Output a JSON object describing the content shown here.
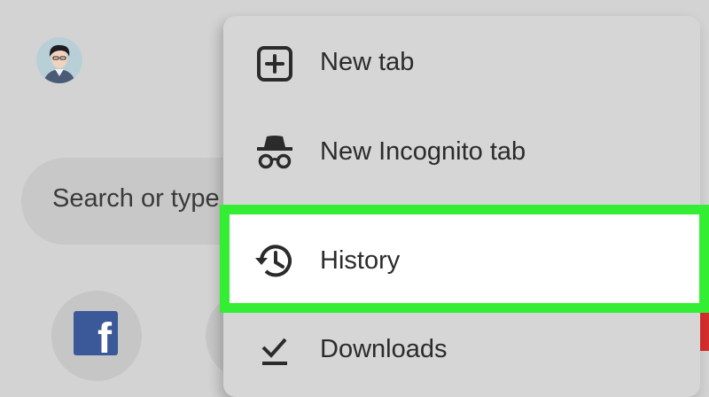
{
  "search": {
    "placeholder_visible": "Search or type"
  },
  "shortcuts": [
    {
      "name": "facebook-shortcut",
      "glyph": "f",
      "color": "#3b5998"
    }
  ],
  "menu": {
    "items": [
      {
        "label": "New tab",
        "icon": "new-tab-icon"
      },
      {
        "label": "New Incognito tab",
        "icon": "incognito-icon"
      },
      {
        "label": "History",
        "icon": "history-icon",
        "highlighted": true
      },
      {
        "label": "Downloads",
        "icon": "downloads-icon"
      }
    ]
  },
  "colors": {
    "highlight_border": "#33ee33",
    "menu_background": "#d6d6d6",
    "page_background": "#d3d3d3"
  }
}
